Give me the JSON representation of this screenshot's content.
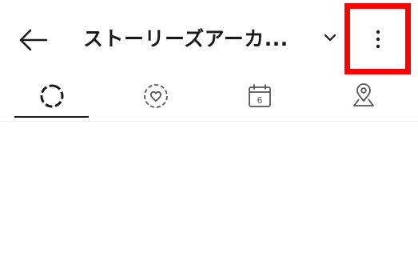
{
  "header": {
    "title": "ストーリーズアーカ...",
    "back_icon": "arrow-left-icon",
    "dropdown_icon": "chevron-down-icon",
    "menu_icon": "more-vertical-icon"
  },
  "highlight": {
    "color": "#ff0000",
    "target": "more-button"
  },
  "tabs": [
    {
      "name": "stories-archive",
      "icon": "story-ring-icon",
      "selected": true
    },
    {
      "name": "highlights",
      "icon": "heart-circle-icon",
      "selected": false
    },
    {
      "name": "calendar",
      "icon": "calendar-icon",
      "calendar_day": "6",
      "selected": false
    },
    {
      "name": "map",
      "icon": "map-pin-icon",
      "selected": false
    }
  ]
}
